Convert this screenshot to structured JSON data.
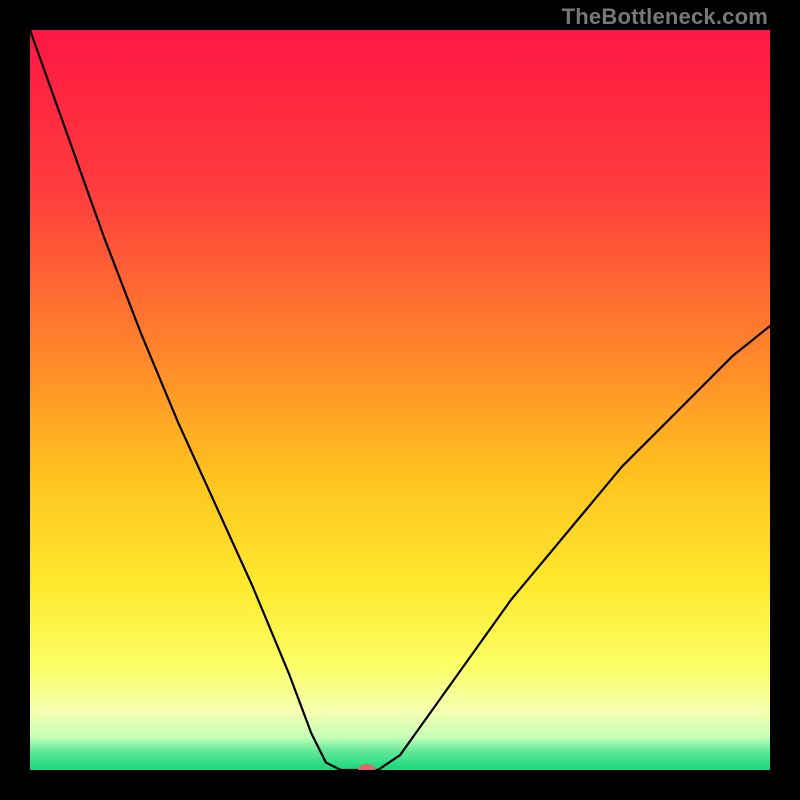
{
  "watermark": "TheBottleneck.com",
  "chart_data": {
    "type": "line",
    "title": "",
    "xlabel": "",
    "ylabel": "",
    "xlim": [
      0,
      1
    ],
    "ylim": [
      0,
      1
    ],
    "gradient_stops": [
      {
        "offset": 0.0,
        "color": "#ff1744"
      },
      {
        "offset": 0.22,
        "color": "#ff3d3d"
      },
      {
        "offset": 0.45,
        "color": "#ff8a2a"
      },
      {
        "offset": 0.6,
        "color": "#ffc21f"
      },
      {
        "offset": 0.75,
        "color": "#ffe92e"
      },
      {
        "offset": 0.86,
        "color": "#fbff66"
      },
      {
        "offset": 0.92,
        "color": "#f5ffb0"
      },
      {
        "offset": 0.955,
        "color": "#c8ffb8"
      },
      {
        "offset": 0.975,
        "color": "#60e89a"
      },
      {
        "offset": 1.0,
        "color": "#17d67a"
      }
    ],
    "series": [
      {
        "name": "bottleneck-curve",
        "x": [
          0.0,
          0.05,
          0.1,
          0.15,
          0.2,
          0.25,
          0.3,
          0.35,
          0.38,
          0.4,
          0.42,
          0.45,
          0.47,
          0.5,
          0.55,
          0.6,
          0.65,
          0.7,
          0.75,
          0.8,
          0.85,
          0.9,
          0.95,
          1.0
        ],
        "y": [
          1.0,
          0.86,
          0.72,
          0.59,
          0.47,
          0.36,
          0.25,
          0.13,
          0.05,
          0.01,
          0.0,
          0.0,
          0.0,
          0.02,
          0.09,
          0.16,
          0.23,
          0.29,
          0.35,
          0.41,
          0.46,
          0.51,
          0.56,
          0.6
        ]
      }
    ],
    "marker": {
      "x": 0.455,
      "y": 0.0,
      "rx": 0.012,
      "ry": 0.008
    },
    "annotations": []
  }
}
